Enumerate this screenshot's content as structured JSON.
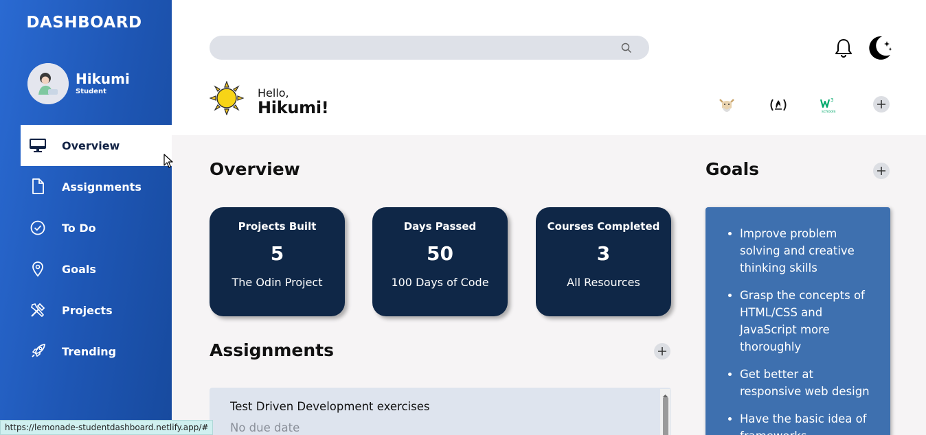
{
  "brand": "DASHBOARD",
  "profile": {
    "name": "Hikumi",
    "role": "Student"
  },
  "nav": [
    {
      "label": "Overview",
      "icon": "monitor-icon",
      "active": true
    },
    {
      "label": "Assignments",
      "icon": "file-icon"
    },
    {
      "label": "To Do",
      "icon": "check-circle-icon"
    },
    {
      "label": "Goals",
      "icon": "map-pin-icon"
    },
    {
      "label": "Projects",
      "icon": "tools-icon"
    },
    {
      "label": "Trending",
      "icon": "rocket-icon"
    }
  ],
  "search": {
    "placeholder": ""
  },
  "greeting": {
    "hello": "Hello,",
    "name": "Hikumi!"
  },
  "overview": {
    "title": "Overview",
    "cards": [
      {
        "title": "Projects Built",
        "value": "5",
        "sub": "The Odin Project"
      },
      {
        "title": "Days Passed",
        "value": "50",
        "sub": "100 Days of Code"
      },
      {
        "title": "Courses Completed",
        "value": "3",
        "sub": "All Resources"
      }
    ]
  },
  "goals": {
    "title": "Goals",
    "items": [
      "Improve problem solving and creative thinking skills",
      "Grasp the concepts of HTML/CSS and JavaScript more thoroughly",
      "Get better at responsive web design",
      "Have the basic idea of frameworks"
    ]
  },
  "assignments": {
    "title": "Assignments",
    "items": [
      {
        "title": "Test Driven Development exercises",
        "due": "No due date"
      }
    ]
  },
  "quicklinks": [
    "odin-project-icon",
    "freecodecamp-icon",
    "w3schools-icon"
  ],
  "w3schools_text": "schools",
  "status_url": "https://lemonade-studentdashboard.netlify.app/#",
  "colors": {
    "sidebar": "#1e56b4",
    "card": "#0f2747",
    "goals_bg": "#3e70af"
  }
}
